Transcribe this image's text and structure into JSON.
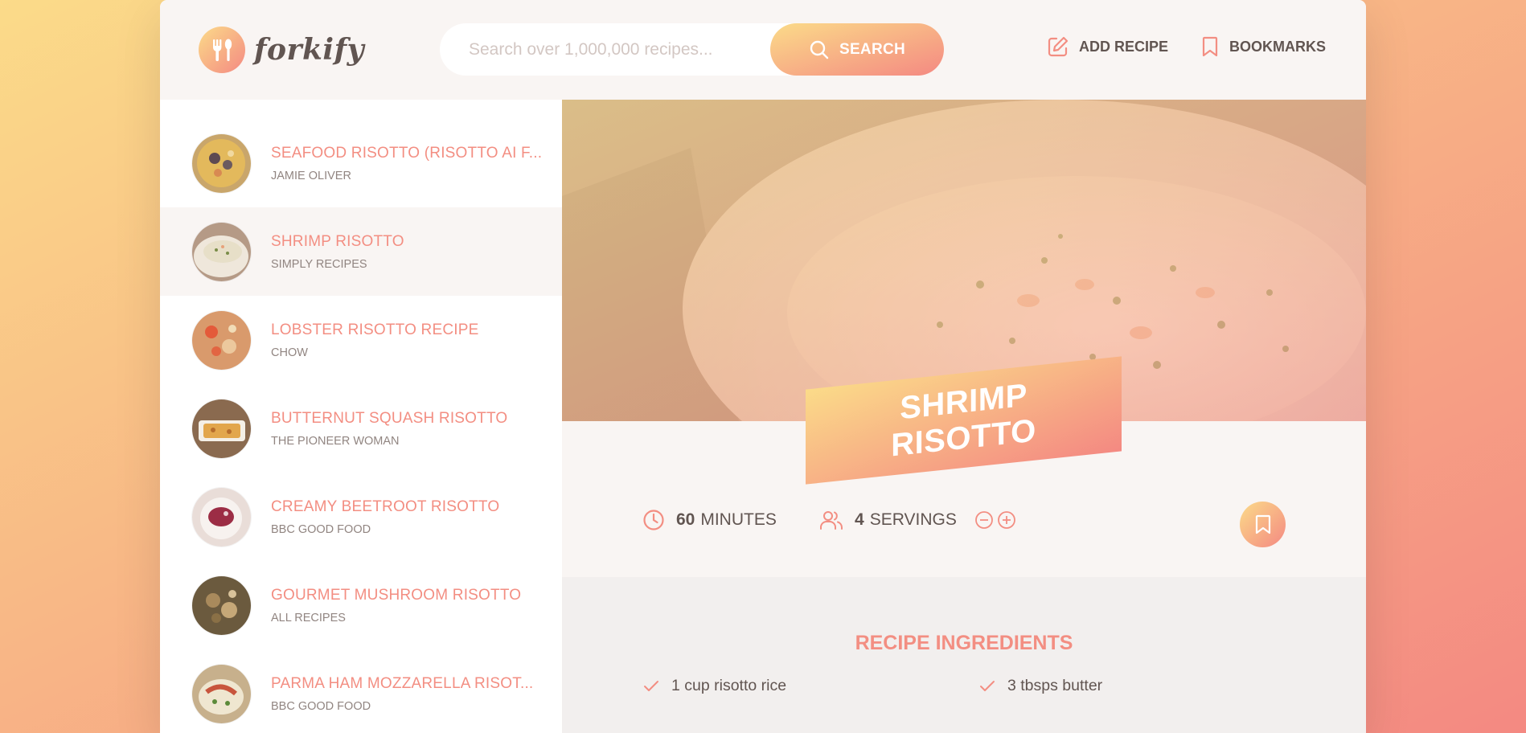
{
  "header": {
    "logo_text": "forkify",
    "search": {
      "placeholder": "Search over 1,000,000 recipes...",
      "button_label": "SEARCH"
    },
    "nav": {
      "add_recipe": "ADD RECIPE",
      "bookmarks": "BOOKMARKS"
    }
  },
  "results": [
    {
      "title": "SEAFOOD RISOTTO (RISOTTO AI F...",
      "publisher": "JAMIE OLIVER",
      "active": false
    },
    {
      "title": "SHRIMP RISOTTO",
      "publisher": "SIMPLY RECIPES",
      "active": true
    },
    {
      "title": "LOBSTER RISOTTO RECIPE",
      "publisher": "CHOW",
      "active": false
    },
    {
      "title": "BUTTERNUT SQUASH RISOTTO",
      "publisher": "THE PIONEER WOMAN",
      "active": false
    },
    {
      "title": "CREAMY BEETROOT RISOTTO",
      "publisher": "BBC GOOD FOOD",
      "active": false
    },
    {
      "title": "GOURMET MUSHROOM RISOTTO",
      "publisher": "ALL RECIPES",
      "active": false
    },
    {
      "title": "PARMA HAM MOZZARELLA RISOT...",
      "publisher": "BBC GOOD FOOD",
      "active": false
    }
  ],
  "recipe": {
    "title": "SHRIMP RISOTTO",
    "cooking_time": "60",
    "cooking_time_unit": "MINUTES",
    "servings": "4",
    "servings_unit": "SERVINGS",
    "ingredients_heading": "RECIPE INGREDIENTS",
    "ingredients": [
      "1 cup risotto rice",
      "3 tbsps butter"
    ]
  },
  "colors": {
    "accent_start": "#fbdb89",
    "accent_end": "#f48982",
    "text": "#615551",
    "title": "#f38e82"
  }
}
